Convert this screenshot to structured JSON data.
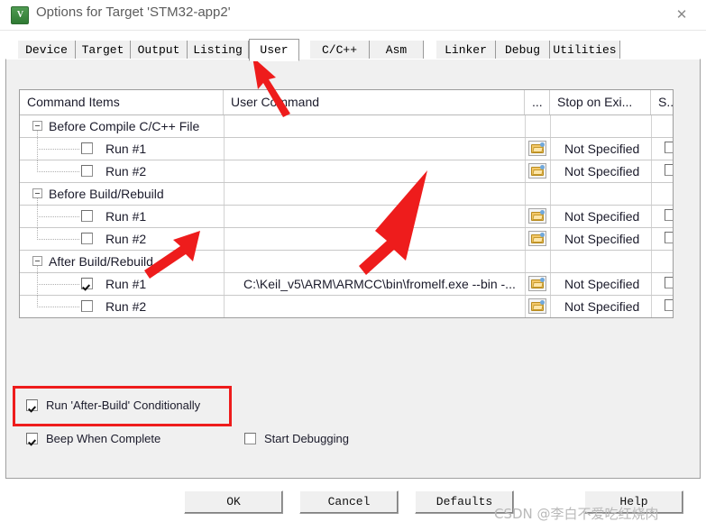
{
  "window": {
    "title": "Options for Target 'STM32-app2'",
    "icon": "keil-uvision-icon",
    "close_label": "✕"
  },
  "tabs": [
    {
      "label": "Device",
      "selected": false
    },
    {
      "label": "Target",
      "selected": false
    },
    {
      "label": "Output",
      "selected": false
    },
    {
      "label": "Listing",
      "selected": false
    },
    {
      "label": "User",
      "selected": true
    },
    {
      "label": "C/C++",
      "selected": false
    },
    {
      "label": "Asm",
      "selected": false
    },
    {
      "label": "Linker",
      "selected": false
    },
    {
      "label": "Debug",
      "selected": false
    },
    {
      "label": "Utilities",
      "selected": false
    }
  ],
  "grid": {
    "headers": [
      "Command Items",
      "User Command",
      "...",
      "Stop on Exi...",
      "S..."
    ],
    "rows": [
      {
        "kind": "group",
        "label": "Before Compile C/C++ File",
        "expanded": true,
        "command": "",
        "has_browse": false,
        "stop_on_exit": "",
        "stop_checked": false
      },
      {
        "kind": "child",
        "label": "Run #1",
        "checked": false,
        "command": "",
        "has_browse": true,
        "stop_on_exit": "Not Specified",
        "stop_checked": false
      },
      {
        "kind": "child",
        "label": "Run #2",
        "checked": false,
        "command": "",
        "has_browse": true,
        "stop_on_exit": "Not Specified",
        "stop_checked": false
      },
      {
        "kind": "group",
        "label": "Before Build/Rebuild",
        "expanded": true,
        "command": "",
        "has_browse": false,
        "stop_on_exit": "",
        "stop_checked": false
      },
      {
        "kind": "child",
        "label": "Run #1",
        "checked": false,
        "command": "",
        "has_browse": true,
        "stop_on_exit": "Not Specified",
        "stop_checked": false
      },
      {
        "kind": "child",
        "label": "Run #2",
        "checked": false,
        "command": "",
        "has_browse": true,
        "stop_on_exit": "Not Specified",
        "stop_checked": false
      },
      {
        "kind": "group",
        "label": "After Build/Rebuild",
        "expanded": true,
        "command": "",
        "has_browse": false,
        "stop_on_exit": "",
        "stop_checked": false
      },
      {
        "kind": "child",
        "label": "Run #1",
        "checked": true,
        "command": "C:\\Keil_v5\\ARM\\ARMCC\\bin\\fromelf.exe --bin -...",
        "has_browse": true,
        "stop_on_exit": "Not Specified",
        "stop_checked": false
      },
      {
        "kind": "child",
        "label": "Run #2",
        "checked": false,
        "command": "",
        "has_browse": true,
        "stop_on_exit": "Not Specified",
        "stop_checked": false
      }
    ]
  },
  "options": {
    "run_after_build_conditionally": {
      "label": "Run 'After-Build' Conditionally",
      "checked": true
    },
    "beep_when_complete": {
      "label": "Beep When Complete",
      "checked": true
    },
    "start_debugging": {
      "label": "Start Debugging",
      "checked": false
    }
  },
  "buttons": {
    "ok": "OK",
    "cancel": "Cancel",
    "defaults": "Defaults",
    "help": "Help"
  },
  "annotations": {
    "highlight_color": "#ee1c1c",
    "arrow_count": 3,
    "watermark": "CSDN @李白不爱吃红烧肉"
  }
}
